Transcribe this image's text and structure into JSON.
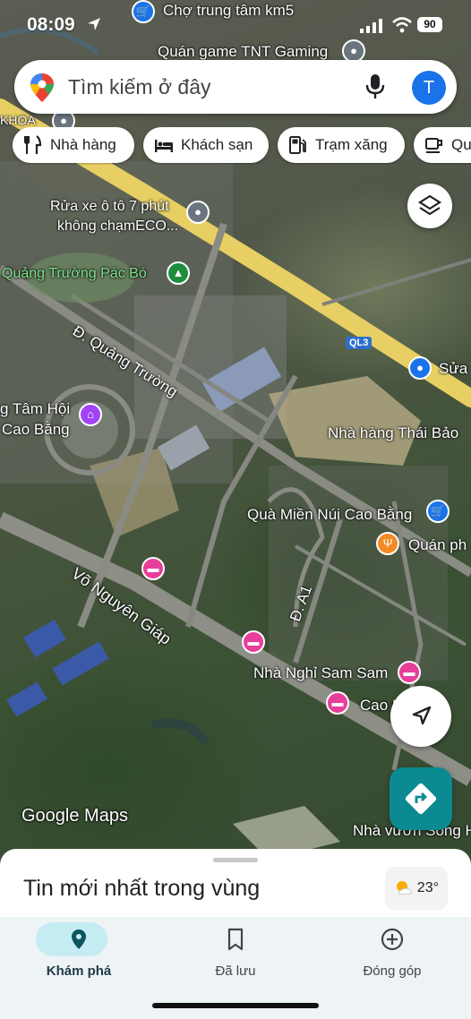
{
  "status_bar": {
    "time": "08:09",
    "battery": "90"
  },
  "search": {
    "placeholder": "Tìm kiếm ở đây",
    "avatar_letter": "T"
  },
  "chips": [
    {
      "label": "Nhà hàng",
      "icon": "fork-knife-icon"
    },
    {
      "label": "Khách sạn",
      "icon": "bed-icon"
    },
    {
      "label": "Trạm xăng",
      "icon": "gas-station-icon"
    },
    {
      "label": "Quá",
      "icon": "coffee-icon"
    }
  ],
  "map_labels": {
    "cho_trung_tam": "Chợ trung tâm km5",
    "quan_game": "Quán game TNT Gaming",
    "khoa": "KHOA",
    "rua_xe_1": "Rửa xe ô tô 7 phút",
    "rua_xe_2": "không chạmECO...",
    "quang_truong_pac_bo": "Quảng Trường Pác Bó",
    "d_quang_truong": "Đ. Quảng Trường",
    "ql3": "QL3",
    "sua": "Sửa",
    "tam_hoi": "g Tâm Hội",
    "cao_bang": "Cao Bằng",
    "nha_hang_thai_bao": "Nhà hàng Thái Bảo",
    "qua_mien_nui": "Quà Miền Núi Cao Bằng",
    "quan_ph": "Quán ph",
    "vo_nguyen_giap": "Võ Nguyên Giáp",
    "d_a1": "Đ. A1",
    "nha_nghi_sam_sam": "Nhà Nghỉ Sam Sam",
    "cao_hoste": "Cao H...oste",
    "nha_vuon": "Nhà vườn Song H",
    "google_maps": "Google Maps"
  },
  "sheet": {
    "title": "Tin mới nhất trong vùng",
    "temperature": "23°"
  },
  "nav": [
    {
      "label": "Khám phá",
      "icon": "location-pin-icon",
      "active": true
    },
    {
      "label": "Đã lưu",
      "icon": "bookmark-icon",
      "active": false
    },
    {
      "label": "Đóng góp",
      "icon": "add-circle-icon",
      "active": false
    }
  ],
  "colors": {
    "accent": "#1a73e8",
    "directions": "#0b8a91",
    "active_pill": "#c6ecf3",
    "hotel_poi": "#e83e9a",
    "shopping_poi": "#1a73e8",
    "food_poi": "#f28b24",
    "park_poi": "#1e8e3e",
    "culture_poi": "#a142f4"
  }
}
